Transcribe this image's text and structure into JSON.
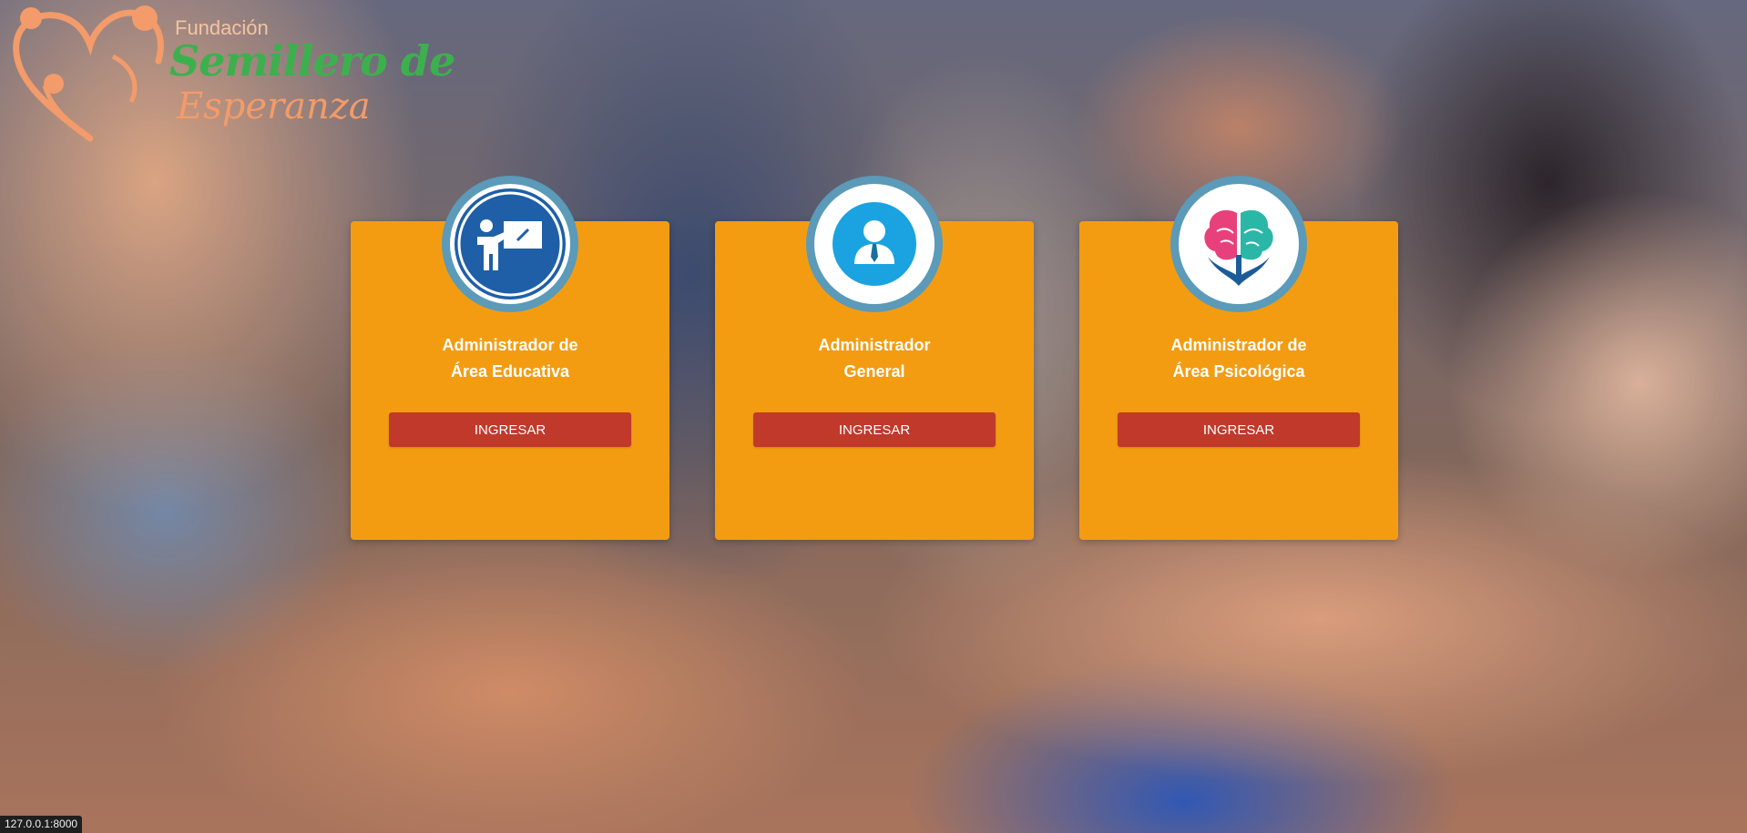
{
  "logo": {
    "line1": "Fundación",
    "line2": "Semillero de",
    "line3": "Esperanza"
  },
  "cards": [
    {
      "icon": "teacher-board-icon",
      "title_line1": "Administrador de",
      "title_line2": "Área Educativa",
      "button_label": "INGRESAR"
    },
    {
      "icon": "user-tie-icon",
      "title_line1": "Administrador",
      "title_line2": "General",
      "button_label": "INGRESAR"
    },
    {
      "icon": "brain-icon",
      "title_line1": "Administrador de",
      "title_line2": "Área Psicológica",
      "button_label": "INGRESAR"
    }
  ],
  "status_bar": {
    "url": "127.0.0.1:8000"
  },
  "colors": {
    "card_background": "#f39c12",
    "button_background": "#c0392b",
    "avatar_ring": "#5b9ab8",
    "logo_green": "#3db04e",
    "logo_orange": "#f39b6a"
  }
}
